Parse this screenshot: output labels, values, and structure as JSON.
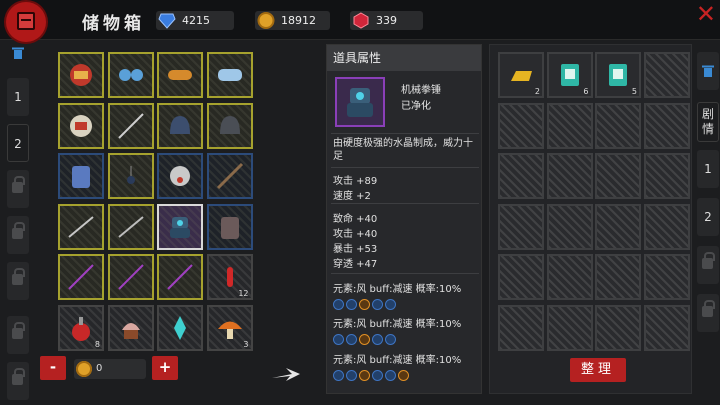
{
  "header": {
    "title": "储物箱",
    "currencies": [
      {
        "icon": "blue-gem-icon",
        "value": "4215"
      },
      {
        "icon": "gold-coin-icon",
        "value": "18912"
      },
      {
        "icon": "red-gem-icon",
        "value": "339"
      }
    ]
  },
  "left_tabs": [
    "1",
    "2"
  ],
  "inventory": [
    [
      {
        "item": "red-gauntlet"
      },
      {
        "item": "goggles"
      },
      {
        "item": "orange-goggles"
      },
      {
        "item": "blue-goggles"
      }
    ],
    [
      {
        "item": "white-gauntlet"
      },
      {
        "item": "katana"
      },
      {
        "item": "blue-helmet"
      },
      {
        "item": "dark-helmet"
      }
    ],
    [
      {
        "item": "blue-armor",
        "frame": "blue"
      },
      {
        "item": "pendant"
      },
      {
        "item": "gas-mask",
        "frame": "blue"
      },
      {
        "item": "rifle",
        "frame": "blue"
      }
    ],
    [
      {
        "item": "blade"
      },
      {
        "item": "blade2"
      },
      {
        "item": "mech-fist",
        "frame": "selected"
      },
      {
        "item": "dark-armor",
        "frame": "blue"
      }
    ],
    [
      {
        "item": "purple-sword"
      },
      {
        "item": "purple-sword2"
      },
      {
        "item": "purple-sword3"
      },
      {
        "item": "red-potion",
        "qty": "12",
        "frame": "empty"
      }
    ],
    [
      {
        "item": "potion-flask",
        "qty": "8",
        "frame": "empty"
      },
      {
        "item": "cupcake",
        "frame": "empty"
      },
      {
        "item": "crystal",
        "frame": "empty"
      },
      {
        "item": "mushroom",
        "qty": "3",
        "frame": "empty"
      }
    ]
  ],
  "amount": {
    "value": "0",
    "minus": "-",
    "plus": "+"
  },
  "info": {
    "header": "道具属性",
    "name": "机械拳锤",
    "state": "已净化",
    "description": "由硬度极强的水晶制成，威力十足",
    "stats_primary": [
      "攻击 +89",
      "速度 +2"
    ],
    "stats_secondary": [
      "致命 +40",
      "攻击 +40",
      "暴击 +53",
      "穿透 +47"
    ],
    "elements": [
      {
        "text": "元素:风 buff:减速 概率:10%",
        "badges": [
          "b",
          "b",
          "o",
          "b",
          "b"
        ]
      },
      {
        "text": "元素:风 buff:减速 概率:10%",
        "badges": [
          "b",
          "b",
          "o",
          "b",
          "b"
        ]
      },
      {
        "text": "元素:风 buff:减速 概率:10%",
        "badges": [
          "b",
          "b",
          "o",
          "b",
          "b",
          "o"
        ]
      }
    ]
  },
  "storage": {
    "items": [
      {
        "item": "gold-bar",
        "qty": "2"
      },
      {
        "item": "tome",
        "qty": "6"
      },
      {
        "item": "tome",
        "qty": "5"
      }
    ],
    "sort_label": "整理"
  },
  "right_tabs": {
    "story": "剧情",
    "pages": [
      "1",
      "2"
    ]
  },
  "colors": {
    "accent_red": "#b52121",
    "slot_gold": "#a6a22e",
    "slot_blue": "#2c4b7a"
  }
}
